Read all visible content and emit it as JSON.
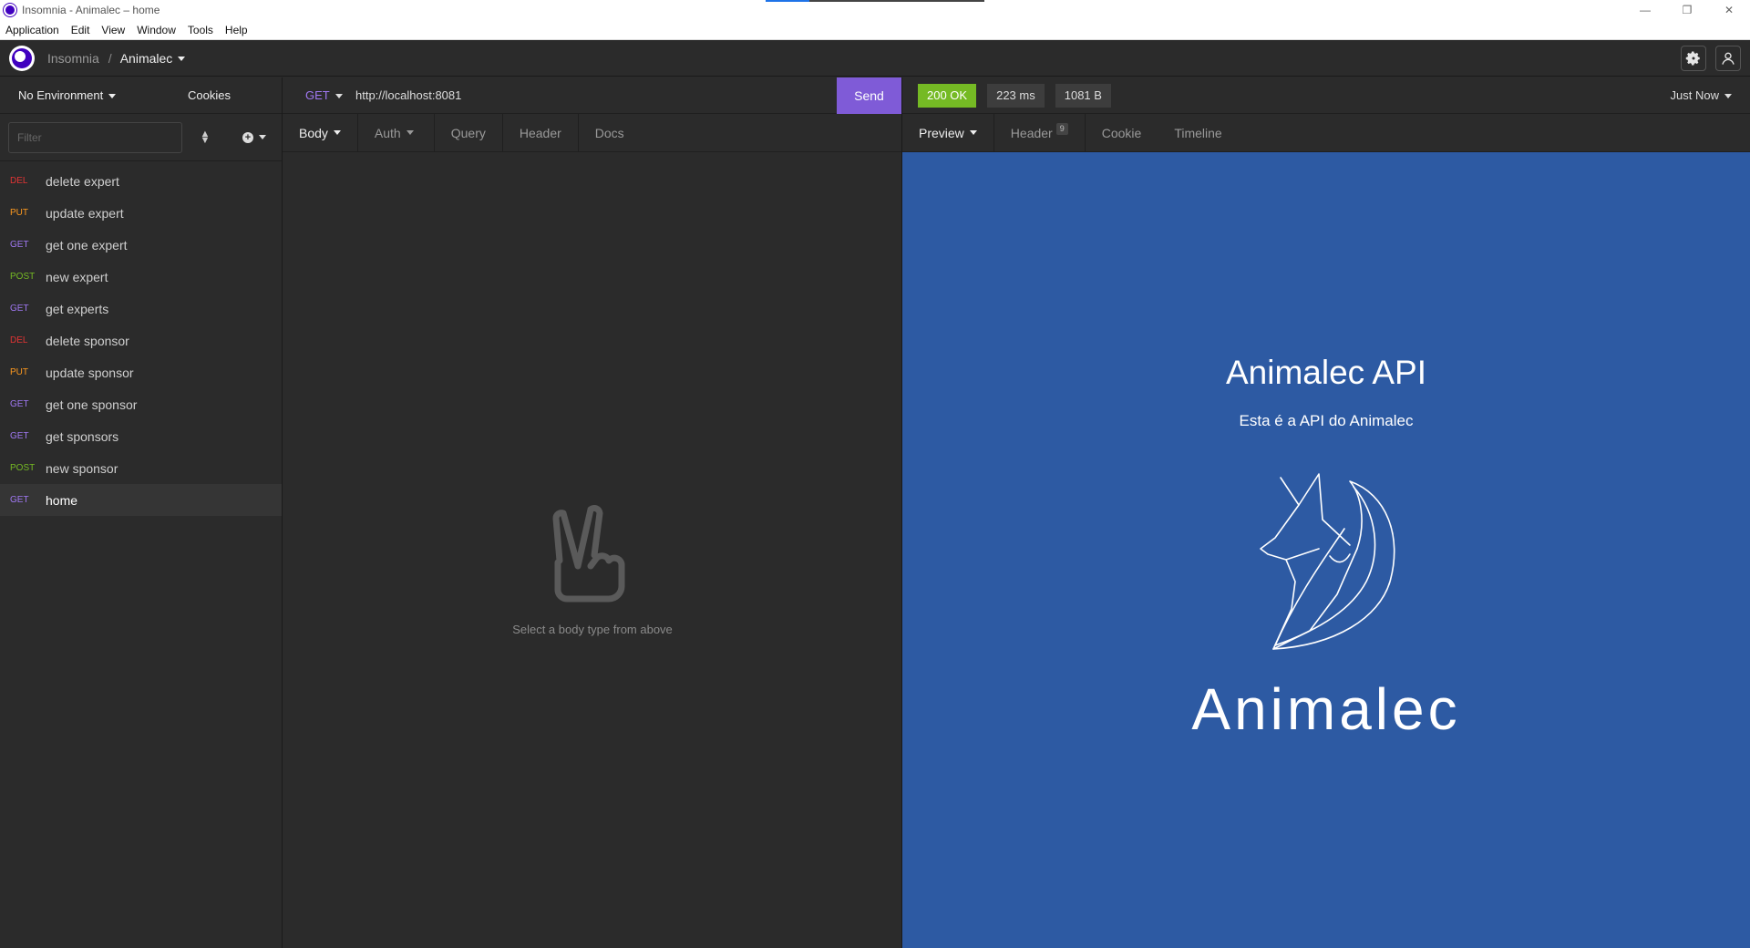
{
  "window": {
    "title": "Insomnia - Animalec – home",
    "controls": [
      "—",
      "❐",
      "✕"
    ]
  },
  "menu": [
    "Application",
    "Edit",
    "View",
    "Window",
    "Tools",
    "Help"
  ],
  "header": {
    "app_name": "Insomnia",
    "separator": "/",
    "workspace": "Animalec"
  },
  "sidebar": {
    "environment": "No Environment",
    "cookies": "Cookies",
    "filter_placeholder": "Filter",
    "requests": [
      {
        "method": "DEL",
        "name": "delete expert",
        "color": "#e23434"
      },
      {
        "method": "PUT",
        "name": "update expert",
        "color": "#ff9a1f"
      },
      {
        "method": "GET",
        "name": "get one expert",
        "color": "#a078f3"
      },
      {
        "method": "POST",
        "name": "new expert",
        "color": "#75ba24"
      },
      {
        "method": "GET",
        "name": "get experts",
        "color": "#a078f3"
      },
      {
        "method": "DEL",
        "name": "delete sponsor",
        "color": "#e23434"
      },
      {
        "method": "PUT",
        "name": "update sponsor",
        "color": "#ff9a1f"
      },
      {
        "method": "GET",
        "name": "get one sponsor",
        "color": "#a078f3"
      },
      {
        "method": "GET",
        "name": "get sponsors",
        "color": "#a078f3"
      },
      {
        "method": "POST",
        "name": "new sponsor",
        "color": "#75ba24"
      },
      {
        "method": "GET",
        "name": "home",
        "color": "#a078f3",
        "active": true
      }
    ]
  },
  "request": {
    "method": "GET",
    "url": "http://localhost:8081",
    "send_label": "Send",
    "tabs": [
      "Body",
      "Auth",
      "Query",
      "Header",
      "Docs"
    ],
    "empty_message": "Select a body type from above"
  },
  "response": {
    "status": "200 OK",
    "time": "223 ms",
    "size": "1081 B",
    "when": "Just Now",
    "tabs": [
      "Preview",
      "Header",
      "Cookie",
      "Timeline"
    ],
    "header_count": "9",
    "preview": {
      "title": "Animalec API",
      "subtitle": "Esta é a API do Animalec",
      "brand": "Animalec",
      "background": "#2d5aa3"
    }
  },
  "colors": {
    "accent": "#7f5bd7",
    "ok": "#75ba24",
    "brand": "#4000bf"
  }
}
